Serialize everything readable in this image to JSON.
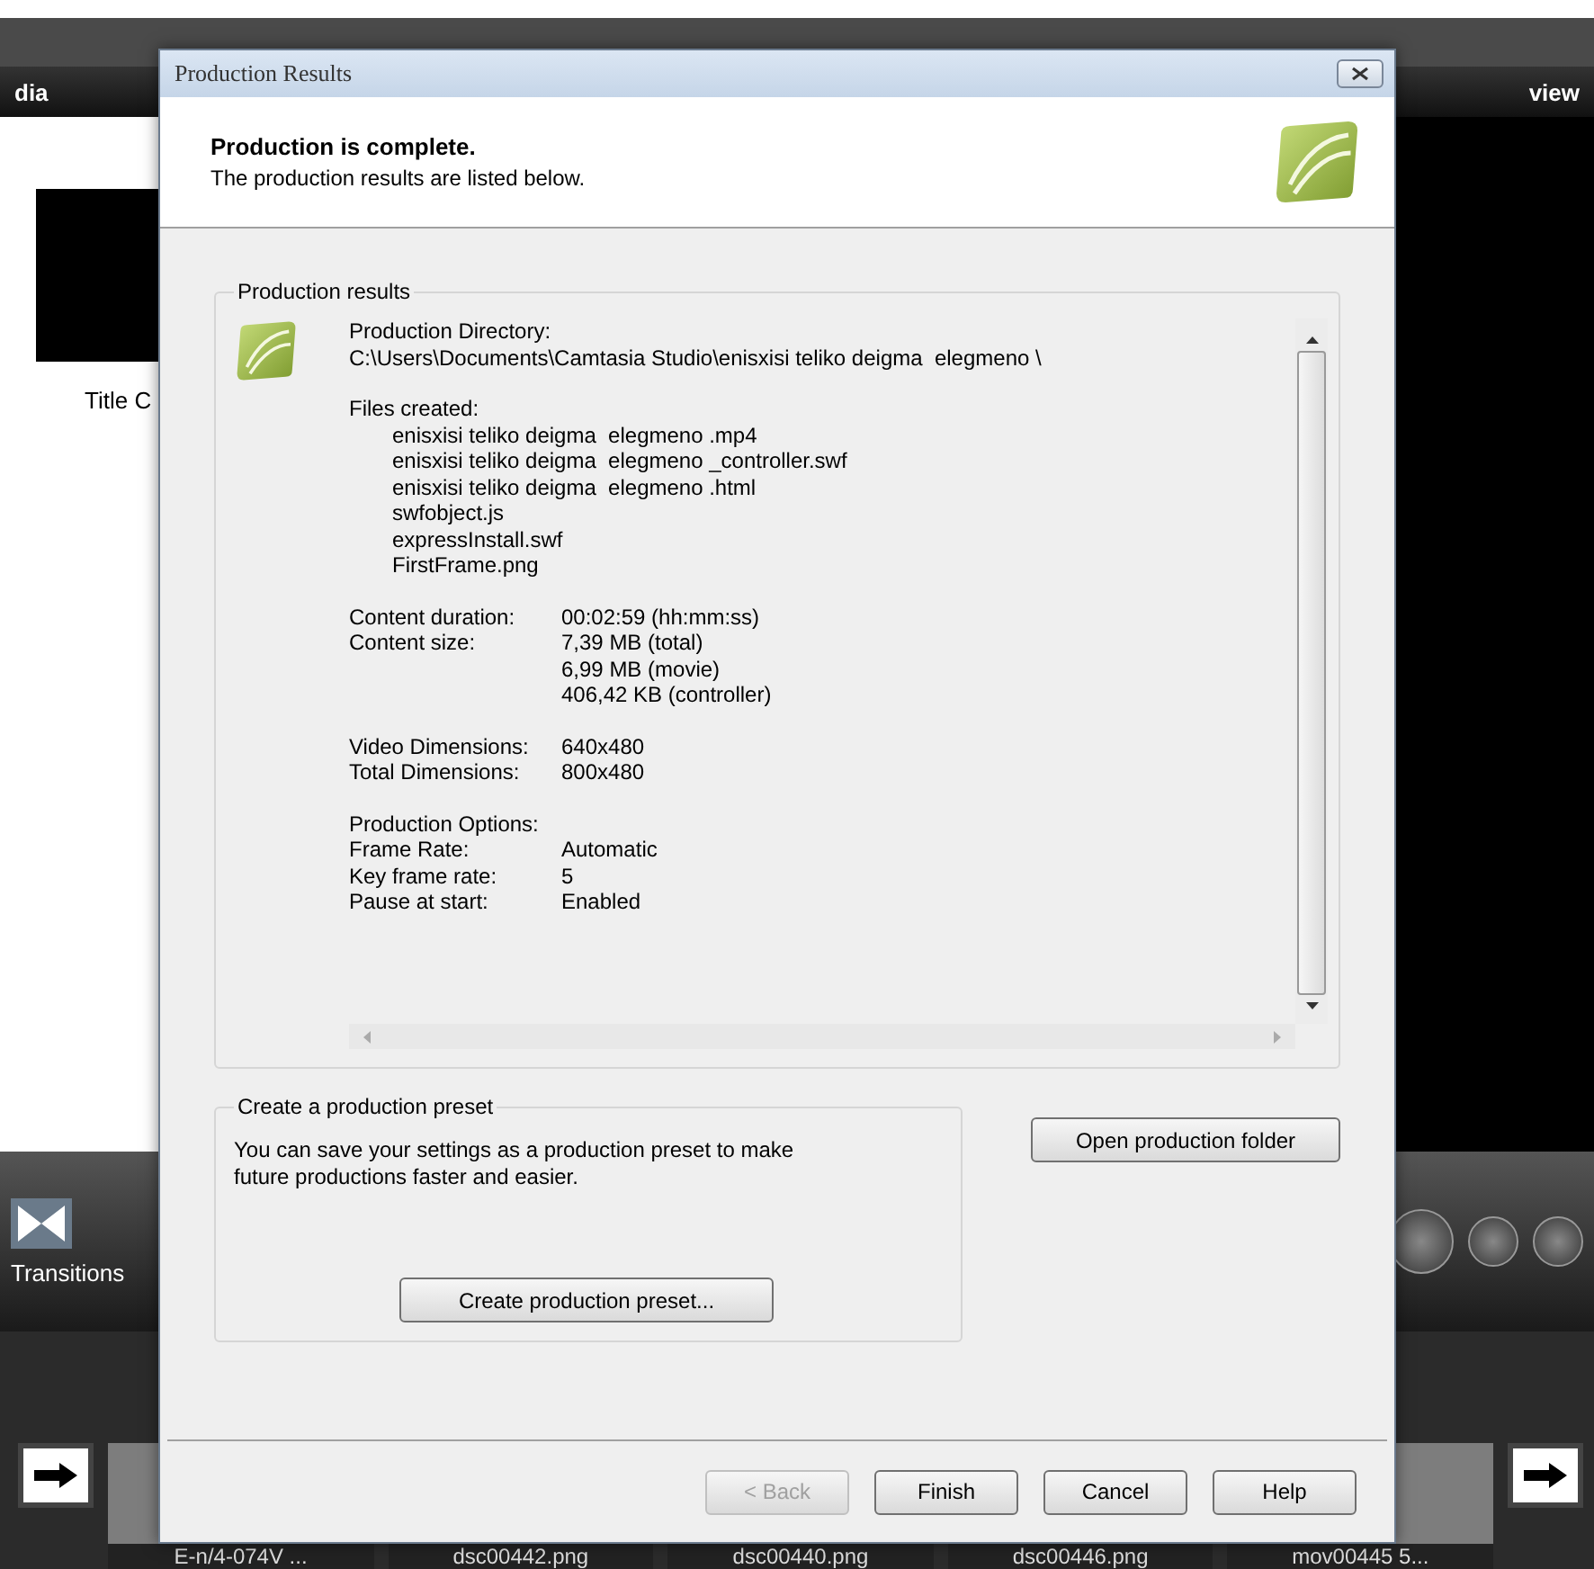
{
  "background_app": {
    "toolbar_left": "dia",
    "toolbar_right": "view",
    "clip_title": "Title C",
    "transitions_label": "Transitions",
    "timeline_clips": [
      "E-n/4-074V ...",
      "dsc00442.png",
      "dsc00440.png",
      "dsc00446.png",
      "mov00445 5..."
    ]
  },
  "dialog": {
    "title": "Production Results",
    "heading": "Production is complete.",
    "subheading": "The production results are listed below.",
    "results": {
      "legend": "Production results",
      "directory_label": "Production Directory:",
      "directory": "C:\\Users\\Documents\\Camtasia Studio\\enisxisi teliko deigma  elegmeno \\",
      "files_label": "Files created:",
      "files": [
        "enisxisi teliko deigma  elegmeno .mp4",
        "enisxisi teliko deigma  elegmeno _controller.swf",
        "enisxisi teliko deigma  elegmeno .html",
        "swfobject.js",
        "expressInstall.swf",
        "FirstFrame.png"
      ],
      "sections": [
        {
          "rows": [
            {
              "label": "Content duration:",
              "values": [
                "00:02:59 (hh:mm:ss)"
              ]
            },
            {
              "label": "Content size:",
              "values": [
                "7,39 MB (total)",
                "6,99 MB (movie)",
                "406,42 KB (controller)"
              ]
            }
          ]
        },
        {
          "rows": [
            {
              "label": "Video Dimensions:",
              "values": [
                "640x480"
              ]
            },
            {
              "label": "Total Dimensions:",
              "values": [
                "800x480"
              ]
            }
          ]
        },
        {
          "heading": "Production Options:",
          "rows": [
            {
              "label": "Frame Rate:",
              "values": [
                "Automatic"
              ]
            },
            {
              "label": "Key frame rate:",
              "values": [
                "5"
              ]
            },
            {
              "label": "Pause at start:",
              "values": [
                "Enabled"
              ]
            }
          ]
        }
      ]
    },
    "preset": {
      "legend": "Create a production preset",
      "description": "You can save your settings as a production preset to make future productions faster and easier.",
      "button": "Create production preset..."
    },
    "open_folder_button": "Open production folder",
    "buttons": [
      {
        "label": "< Back",
        "disabled": true
      },
      {
        "label": "Finish",
        "disabled": false
      },
      {
        "label": "Cancel",
        "disabled": false
      },
      {
        "label": "Help",
        "disabled": false
      }
    ]
  }
}
